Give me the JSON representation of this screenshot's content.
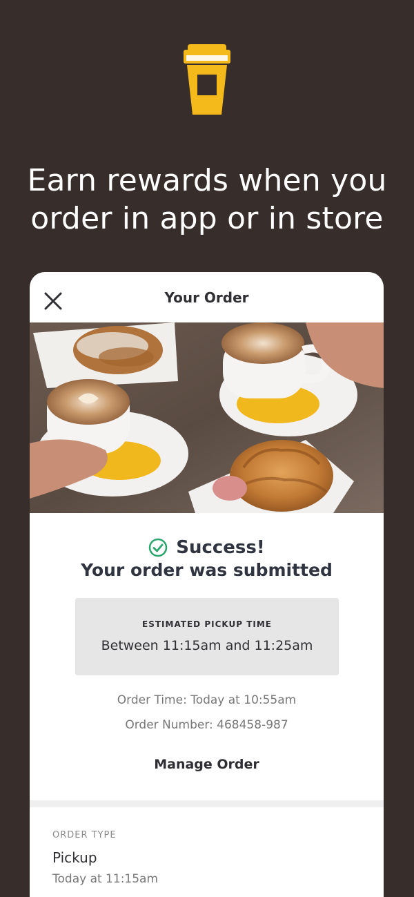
{
  "promo": {
    "headline_line1": "Earn rewards when you",
    "headline_line2": "order in app or in store"
  },
  "brand": {
    "icon": "coffee-cup-icon",
    "accent_color": "#f4b91b",
    "background_color": "#372d2a"
  },
  "order_card": {
    "title": "Your Order",
    "close_icon": "close-icon",
    "image_description": "coffee-and-croissants-photo",
    "success": {
      "icon": "check-circle-icon",
      "heading": "Success!",
      "message": "Your order was submitted",
      "icon_color": "#2aa56b"
    },
    "pickup": {
      "label": "ESTIMATED PICKUP TIME",
      "time": "Between 11:15am and 11:25am"
    },
    "order_time": "Order Time: Today at 10:55am",
    "order_number": "Order Number: 468458-987",
    "manage_label": "Manage Order",
    "order_type": {
      "label": "ORDER TYPE",
      "value": "Pickup",
      "time": "Today at 11:15am"
    }
  }
}
